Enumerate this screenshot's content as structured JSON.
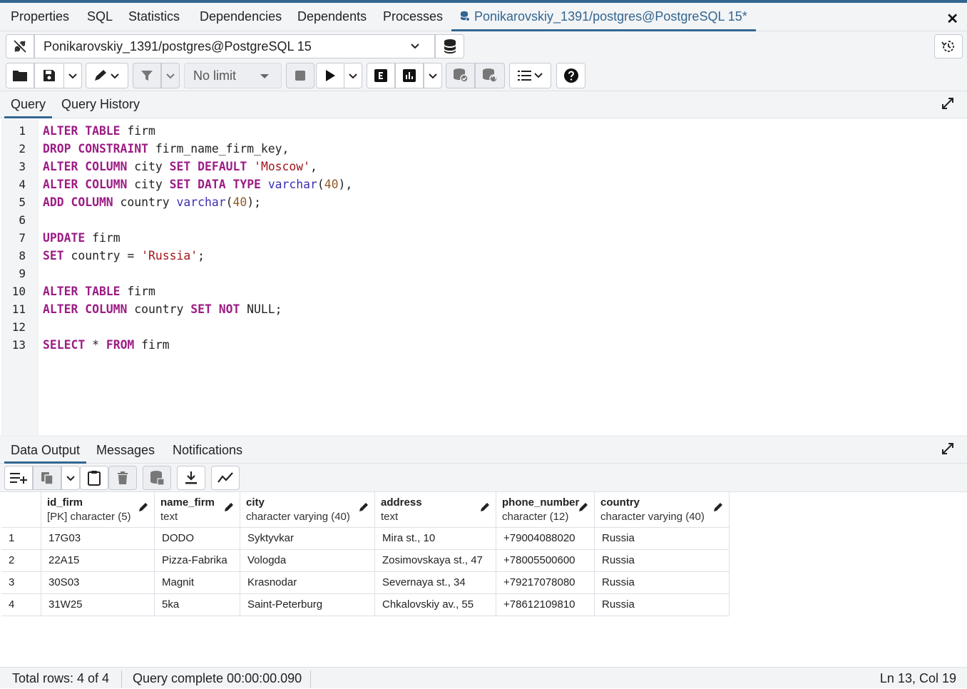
{
  "window_tabs": [
    {
      "label": "Properties"
    },
    {
      "label": "SQL"
    },
    {
      "label": "Statistics"
    },
    {
      "label": "Dependencies"
    },
    {
      "label": "Dependents"
    },
    {
      "label": "Processes"
    },
    {
      "label": "Ponikarovskiy_1391/postgres@PostgreSQL 15*",
      "icon": "database-icon",
      "active": true
    }
  ],
  "connection": {
    "selected": "Ponikarovskiy_1391/postgres@PostgreSQL 15"
  },
  "toolbar": {
    "limit_label": "No limit"
  },
  "query_tabs": [
    {
      "label": "Query",
      "active": true
    },
    {
      "label": "Query History"
    }
  ],
  "editor": {
    "line_numbers": [
      "1",
      "2",
      "3",
      "4",
      "5",
      "6",
      "7",
      "8",
      "9",
      "10",
      "11",
      "12",
      "13"
    ]
  },
  "output_tabs": [
    {
      "label": "Data Output",
      "active": true
    },
    {
      "label": "Messages"
    },
    {
      "label": "Notifications"
    }
  ],
  "grid": {
    "columns": [
      {
        "name": "id_firm",
        "type": "[PK] character (5)"
      },
      {
        "name": "name_firm",
        "type": "text"
      },
      {
        "name": "city",
        "type": "character varying (40)"
      },
      {
        "name": "address",
        "type": "text"
      },
      {
        "name": "phone_number",
        "type": "character (12)"
      },
      {
        "name": "country",
        "type": "character varying (40)"
      }
    ],
    "rows": [
      {
        "n": "1",
        "cells": [
          "17G03",
          "DODO",
          "Syktyvkar",
          "Mira st., 10",
          "+79004088020",
          "Russia"
        ]
      },
      {
        "n": "2",
        "cells": [
          "22A15",
          "Pizza-Fabrika",
          "Vologda",
          "Zosimovskaya st., 47",
          "+78005500600",
          "Russia"
        ]
      },
      {
        "n": "3",
        "cells": [
          "30S03",
          "Magnit",
          "Krasnodar",
          "Severnaya st., 34",
          "+79217078080",
          "Russia"
        ]
      },
      {
        "n": "4",
        "cells": [
          "31W25",
          "5ka",
          "Saint-Peterburg",
          "Chkalovskiy av., 55",
          "+78612109810",
          "Russia"
        ]
      }
    ]
  },
  "status": {
    "total_rows": "Total rows: 4 of 4",
    "query_complete": "Query complete 00:00:00.090",
    "cursor": "Ln 13, Col 19"
  }
}
